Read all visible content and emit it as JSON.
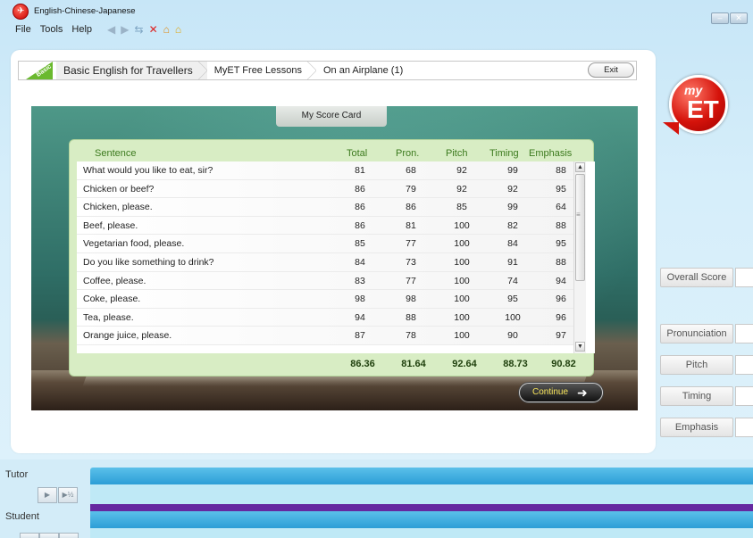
{
  "window": {
    "title": "English-Chinese-Japanese",
    "minimize_glyph": "–",
    "close_glyph": "✕"
  },
  "menu": [
    "File",
    "Tools",
    "Help"
  ],
  "toolbar": {
    "icons": [
      "back-icon",
      "forward-icon",
      "refresh-icon",
      "stop-icon",
      "home-icon",
      "home-alt-icon"
    ]
  },
  "breadcrumb": {
    "badge": "Basic",
    "items": [
      "Basic English for Travellers",
      "MyET Free Lessons",
      "On an Airplane (1)"
    ],
    "exit_label": "Exit"
  },
  "score_card": {
    "tab_label": "My Score Card",
    "headers": {
      "sentence": "Sentence",
      "total": "Total",
      "pron": "Pron.",
      "pitch": "Pitch",
      "timing": "Timing",
      "emphasis": "Emphasis"
    },
    "rows": [
      {
        "sentence": "What would you like to eat, sir?",
        "total": "81",
        "pron": "68",
        "pitch": "92",
        "timing": "99",
        "emphasis": "88"
      },
      {
        "sentence": "Chicken or beef?",
        "total": "86",
        "pron": "79",
        "pitch": "92",
        "timing": "92",
        "emphasis": "95"
      },
      {
        "sentence": "Chicken, please.",
        "total": "86",
        "pron": "86",
        "pitch": "85",
        "timing": "99",
        "emphasis": "64"
      },
      {
        "sentence": "Beef, please.",
        "total": "86",
        "pron": "81",
        "pitch": "100",
        "timing": "82",
        "emphasis": "88"
      },
      {
        "sentence": "Vegetarian food, please.",
        "total": "85",
        "pron": "77",
        "pitch": "100",
        "timing": "84",
        "emphasis": "95"
      },
      {
        "sentence": "Do you like something to drink?",
        "total": "84",
        "pron": "73",
        "pitch": "100",
        "timing": "91",
        "emphasis": "88"
      },
      {
        "sentence": "Coffee, please.",
        "total": "83",
        "pron": "77",
        "pitch": "100",
        "timing": "74",
        "emphasis": "94"
      },
      {
        "sentence": "Coke, please.",
        "total": "98",
        "pron": "98",
        "pitch": "100",
        "timing": "95",
        "emphasis": "96"
      },
      {
        "sentence": "Tea, please.",
        "total": "94",
        "pron": "88",
        "pitch": "100",
        "timing": "100",
        "emphasis": "96"
      },
      {
        "sentence": "Orange juice, please.",
        "total": "87",
        "pron": "78",
        "pitch": "100",
        "timing": "90",
        "emphasis": "97"
      }
    ],
    "averages": {
      "total": "86.36",
      "pron": "81.64",
      "pitch": "92.64",
      "timing": "88.73",
      "emphasis": "90.82"
    },
    "continue_label": "Continue"
  },
  "logo": {
    "my": "my",
    "et": "ET"
  },
  "side_buttons": {
    "overall": "Overall Score",
    "pronunciation": "Pronunciation",
    "pitch": "Pitch",
    "timing": "Timing",
    "emphasis": "Emphasis"
  },
  "bottom": {
    "tutor_label": "Tutor",
    "student_label": "Student",
    "play_glyph": "▶",
    "half_speed_glyph": "▶½"
  },
  "colors": {
    "accent_green": "#3c7a1e",
    "badge_green": "#6ab92e",
    "track_blue": "#2c9ed6",
    "track_purple": "#6528a0",
    "logo_red": "#d5130b"
  }
}
